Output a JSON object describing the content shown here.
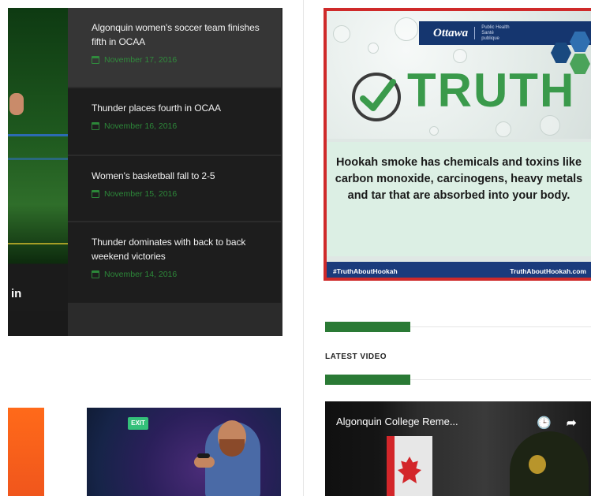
{
  "hero": {
    "caption": "in"
  },
  "news": [
    {
      "title": "Algonquin women's soccer team finishes fifth in OCAA",
      "date": "November 17, 2016"
    },
    {
      "title": "Thunder places fourth in OCAA",
      "date": "November 16, 2016"
    },
    {
      "title": "Women's basketball fall to 2-5",
      "date": "November 15, 2016"
    },
    {
      "title": "Thunder dominates with back to back weekend victories",
      "date": "November 14, 2016"
    }
  ],
  "ad": {
    "logo": "Ottawa",
    "logo_sub": "Public Health Santé publique",
    "headline": "TRUTH",
    "body": "Hookah smoke has chemicals and toxins like carbon monoxide, carcinogens, heavy metals and tar that are absorbed into your body.",
    "hashtag": "#TruthAboutHookah",
    "url": "TruthAboutHookah.com",
    "colors": {
      "border": "#cf2a2a",
      "green": "#3a9a4b",
      "navy": "#15366f"
    }
  },
  "latest_video": {
    "heading": "LATEST VIDEO",
    "title": "Algonquin College Reme...",
    "clock_icon": "🕒",
    "share_icon": "➦"
  },
  "card2": {
    "exit_sign": "EXIT"
  }
}
